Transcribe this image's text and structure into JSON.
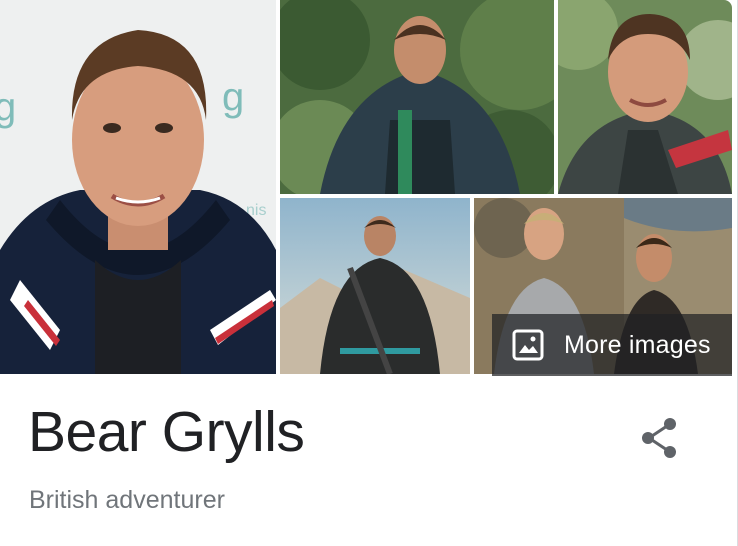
{
  "gallery": {
    "more_images_label": "More images",
    "images": [
      {
        "icon": "person-portrait-photo"
      },
      {
        "icon": "person-outdoor-forest-photo"
      },
      {
        "icon": "person-smiling-photo"
      },
      {
        "icon": "person-mountain-gear-photo"
      },
      {
        "icon": "two-people-outdoors-photo"
      }
    ],
    "more_images_icon": "image-icon"
  },
  "entity": {
    "title": "Bear Grylls",
    "subtitle": "British adventurer"
  },
  "actions": {
    "share_icon": "share-icon"
  },
  "colors": {
    "title": "#202124",
    "subtitle": "#70757a",
    "share_icon": "#5f6368",
    "overlay": "#202124"
  }
}
